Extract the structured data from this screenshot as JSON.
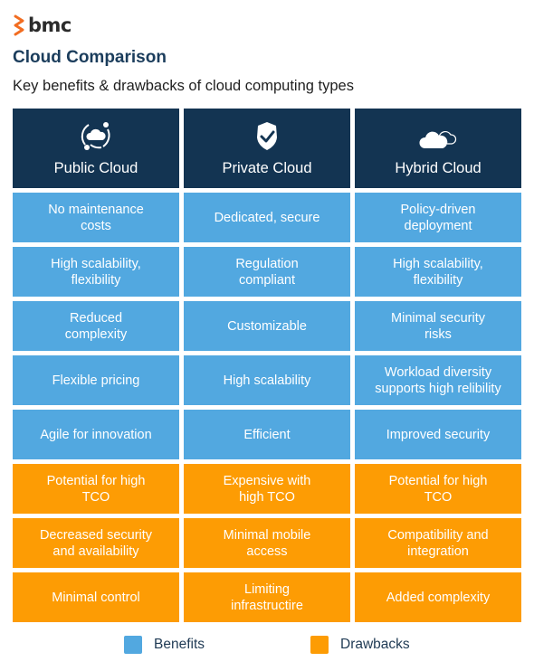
{
  "brand": {
    "logo_text": "bmc",
    "logo_icon": "bmc-chevron-logo-icon",
    "accent_color": "#f26d21"
  },
  "title": "Cloud Comparison",
  "subtitle": "Key benefits & drawbacks of cloud computing types",
  "colors": {
    "header_bg": "#133452",
    "benefit": "#52a8e0",
    "drawback": "#fd9c04",
    "title": "#1b3d5c"
  },
  "columns": [
    {
      "label": "Public Cloud",
      "icon": "public-cloud-icon"
    },
    {
      "label": "Private Cloud",
      "icon": "shield-check-icon"
    },
    {
      "label": "Hybrid Cloud",
      "icon": "hybrid-cloud-icon"
    }
  ],
  "rows": [
    {
      "type": "benefit",
      "cells": [
        "No maintenance\ncosts",
        "Dedicated, secure",
        "Policy-driven\ndeployment"
      ]
    },
    {
      "type": "benefit",
      "cells": [
        "High scalability,\nflexibility",
        "Regulation\ncompliant",
        "High scalability,\nflexibility"
      ]
    },
    {
      "type": "benefit",
      "cells": [
        "Reduced\ncomplexity",
        "Customizable",
        "Minimal security\nrisks"
      ]
    },
    {
      "type": "benefit",
      "cells": [
        "Flexible pricing",
        "High scalability",
        "Workload diversity\nsupports high relibility"
      ]
    },
    {
      "type": "benefit",
      "cells": [
        "Agile for innovation",
        "Efficient",
        "Improved security"
      ]
    },
    {
      "type": "drawback",
      "cells": [
        "Potential for high\nTCO",
        "Expensive with\nhigh TCO",
        "Potential for high\nTCO"
      ]
    },
    {
      "type": "drawback",
      "cells": [
        "Decreased security\nand availability",
        "Minimal mobile\naccess",
        "Compatibility and\nintegration"
      ]
    },
    {
      "type": "drawback",
      "cells": [
        "Minimal control",
        "Limiting\ninfrastructire",
        "Added complexity"
      ]
    }
  ],
  "legend": [
    {
      "label": "Benefits",
      "color": "#52a8e0"
    },
    {
      "label": "Drawbacks",
      "color": "#fd9c04"
    }
  ]
}
